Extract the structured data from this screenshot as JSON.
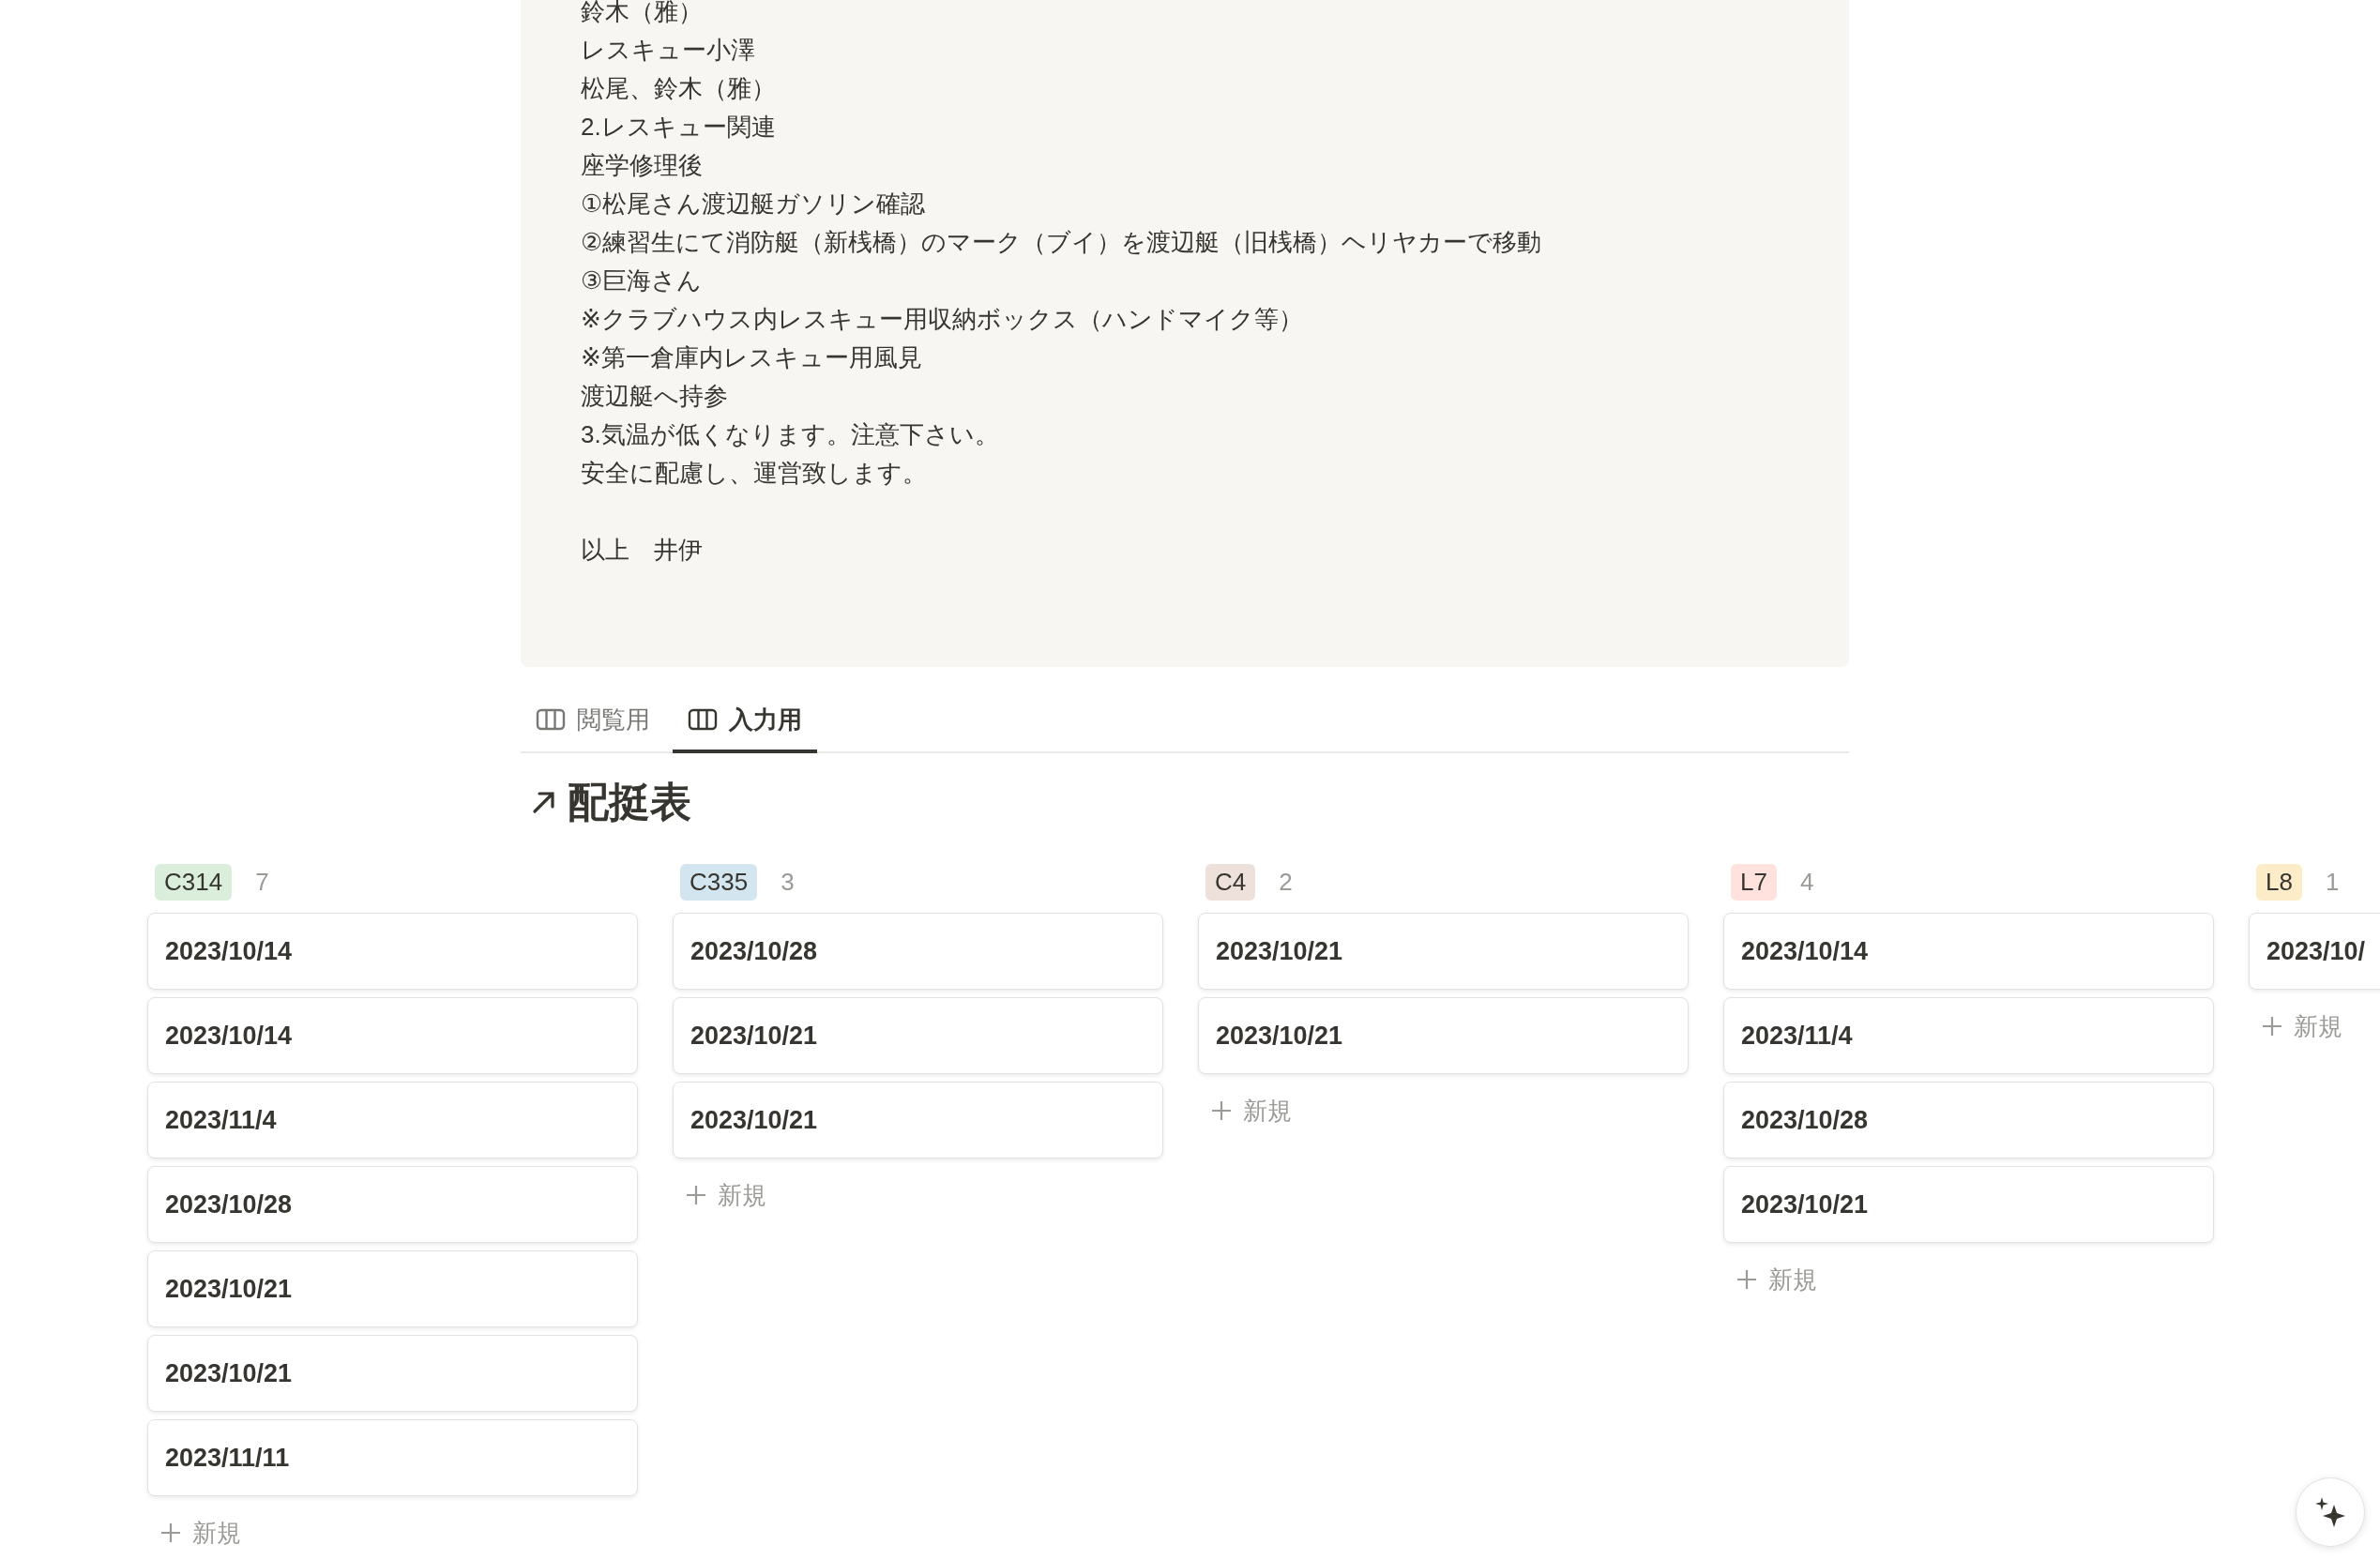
{
  "note": {
    "paragraphs": [
      [
        "鈴木（雅）",
        "レスキュー小澤",
        "松尾、鈴木（雅）",
        "2.レスキュー関連",
        "座学修理後",
        "①松尾さん渡辺艇ガソリン確認",
        "②練習生にて消防艇（新桟橋）のマーク（ブイ）を渡辺艇（旧桟橋）ヘリヤカーで移動",
        "③巨海さん",
        "※クラブハウス内レスキュー用収納ボックス（ハンドマイク等）",
        "※第一倉庫内レスキュー用風見",
        "渡辺艇へ持参",
        "3.気温が低くなります。注意下さい。",
        "安全に配慮し、運営致します。"
      ],
      [
        "以上　井伊"
      ]
    ]
  },
  "tabs": [
    {
      "label": "閲覧用",
      "selected": false
    },
    {
      "label": "入力用",
      "selected": true
    }
  ],
  "database": {
    "title": "配挺表"
  },
  "columns": [
    {
      "tag": "C314",
      "count": "7",
      "color": "#dbeddb",
      "cards": [
        "2023/10/14",
        "2023/10/14",
        "2023/11/4",
        "2023/10/28",
        "2023/10/21",
        "2023/10/21",
        "2023/11/11"
      ],
      "new_label": "新規"
    },
    {
      "tag": "C335",
      "count": "3",
      "color": "#d3e5ef",
      "cards": [
        "2023/10/28",
        "2023/10/21",
        "2023/10/21"
      ],
      "new_label": "新規"
    },
    {
      "tag": "C4",
      "count": "2",
      "color": "#eee0da",
      "cards": [
        "2023/10/21",
        "2023/10/21"
      ],
      "new_label": "新規"
    },
    {
      "tag": "L7",
      "count": "4",
      "color": "#ffe2dd",
      "cards": [
        "2023/10/14",
        "2023/11/4",
        "2023/10/28",
        "2023/10/21"
      ],
      "new_label": "新規"
    },
    {
      "tag": "L8",
      "count": "1",
      "color": "#fdecc8",
      "cards": [
        "2023/10/"
      ],
      "new_label": "新規"
    }
  ]
}
